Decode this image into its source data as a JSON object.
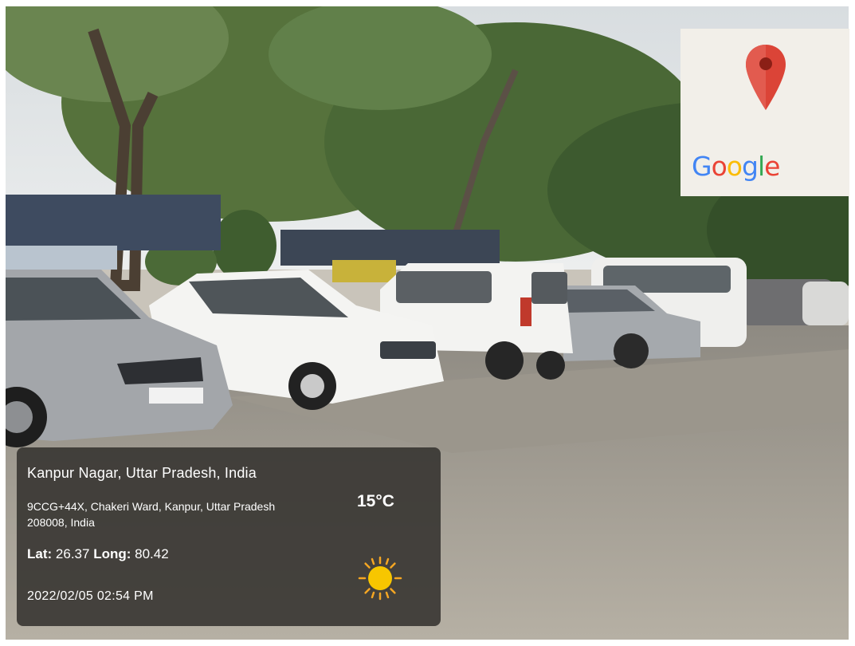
{
  "photo": {
    "subject": "parking-lot-with-cars",
    "colors": {
      "sky": "#dfe3e6",
      "foliage": "#4f6b3a",
      "ground": "#a9a397",
      "car_white": "#f1f1ef",
      "car_silver": "#9a9ea2"
    }
  },
  "map_card": {
    "logo_text": "Google",
    "logo_colors": [
      "#4285F4",
      "#EA4335",
      "#FBBC05",
      "#4285F4",
      "#34A853",
      "#EA4335"
    ],
    "pin_color": "#DB4437",
    "icon": "map-pin-icon"
  },
  "info": {
    "location": "Kanpur Nagar, Uttar Pradesh, India",
    "address": "9CCG+44X, Chakeri Ward, Kanpur, Uttar Pradesh 208008, India",
    "lat_label": "Lat:",
    "lat_value": "26.37",
    "long_label": "Long:",
    "long_value": "80.42",
    "datetime": "2022/02/05 02:54 PM",
    "temperature": "15°C",
    "weather_icon": "sun-icon",
    "panel_color": "#34322f"
  }
}
